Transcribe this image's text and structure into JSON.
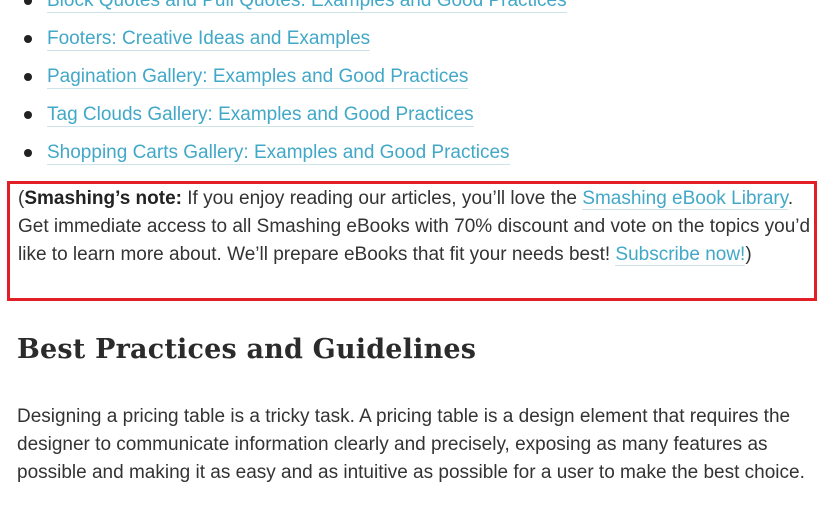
{
  "related_links": [
    {
      "label": "Block Quotes and Pull Quotes: Examples and Good Practices"
    },
    {
      "label": "Footers: Creative Ideas and Examples"
    },
    {
      "label": "Pagination Gallery: Examples and Good Practices"
    },
    {
      "label": "Tag Clouds Gallery: Examples and Good Practices"
    },
    {
      "label": "Shopping Carts Gallery: Examples and Good Practices"
    }
  ],
  "note": {
    "open_paren": "(",
    "label": "Smashing’s note:",
    "text_1": " If you enjoy reading our articles, you’ll love the ",
    "library_link": "Smashing eBook Library",
    "text_2": ". Get immediate access to all Smashing eBooks with 70% discount and vote on the topics you’d like to learn more about. We’ll prepare eBooks that fit your needs best! ",
    "subscribe_link": "Subscribe now!",
    "close_paren": ")",
    "highlight_color": "#e21f26"
  },
  "section": {
    "heading": "Best Practices and Guidelines",
    "paragraph": "Designing a pricing table is a tricky task. A pricing table is a design element that requires the designer to communicate information clearly and precisely, exposing as many features as possible and making it as easy and as intuitive as possible for a user to make the best choice."
  },
  "colors": {
    "link": "#42a8c8",
    "text": "#333333",
    "highlight_border": "#e21f26"
  }
}
